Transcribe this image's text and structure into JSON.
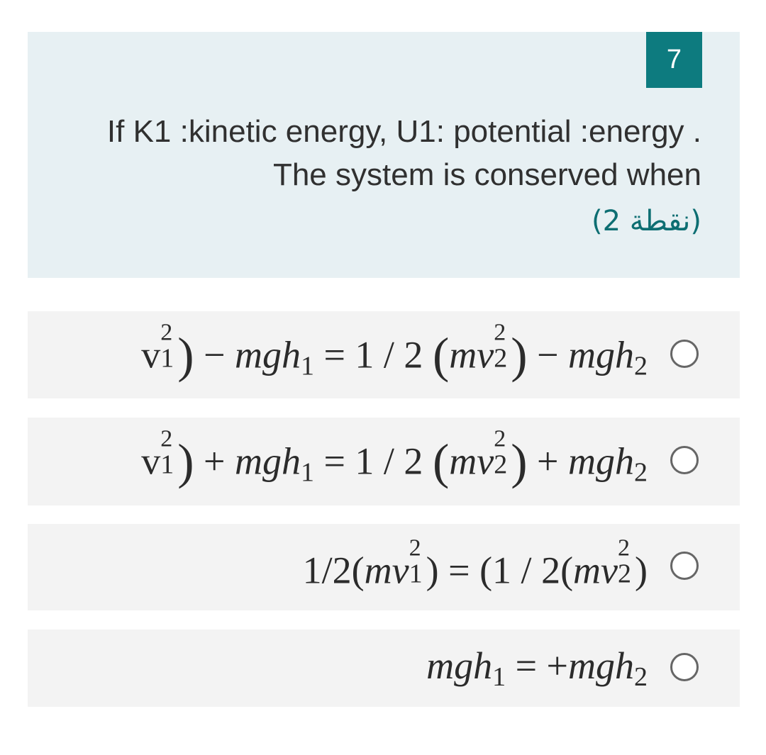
{
  "question": {
    "number": "7",
    "text": "If  K1 :kinetic energy, U1: potential :energy . The system is conserved when",
    "points": "(2 نقطة)"
  },
  "options": [
    {
      "left_visible": "v",
      "pre_sign": "−",
      "rhs": "= 1 / 2",
      "post_sign": "−",
      "formula_text": "v12) − mgh1 = 1 / 2 (mv22) − mgh2"
    },
    {
      "left_visible": "v",
      "pre_sign": "+",
      "rhs": "= 1 / 2",
      "post_sign": "+",
      "formula_text": "v12) + mgh1 = 1 / 2 (mv22) + mgh2"
    },
    {
      "formula_text": "1/2(mv12) = (1 / 2(mv22)"
    },
    {
      "formula_text": "mgh1 = +mgh2"
    }
  ],
  "colors": {
    "question_bg": "#e7f0f3",
    "number_badge": "#0d7b7f",
    "points_text": "#0d6e72",
    "option_bg": "#f3f3f3"
  },
  "icons": {
    "radio": "radio-unchecked-icon"
  }
}
